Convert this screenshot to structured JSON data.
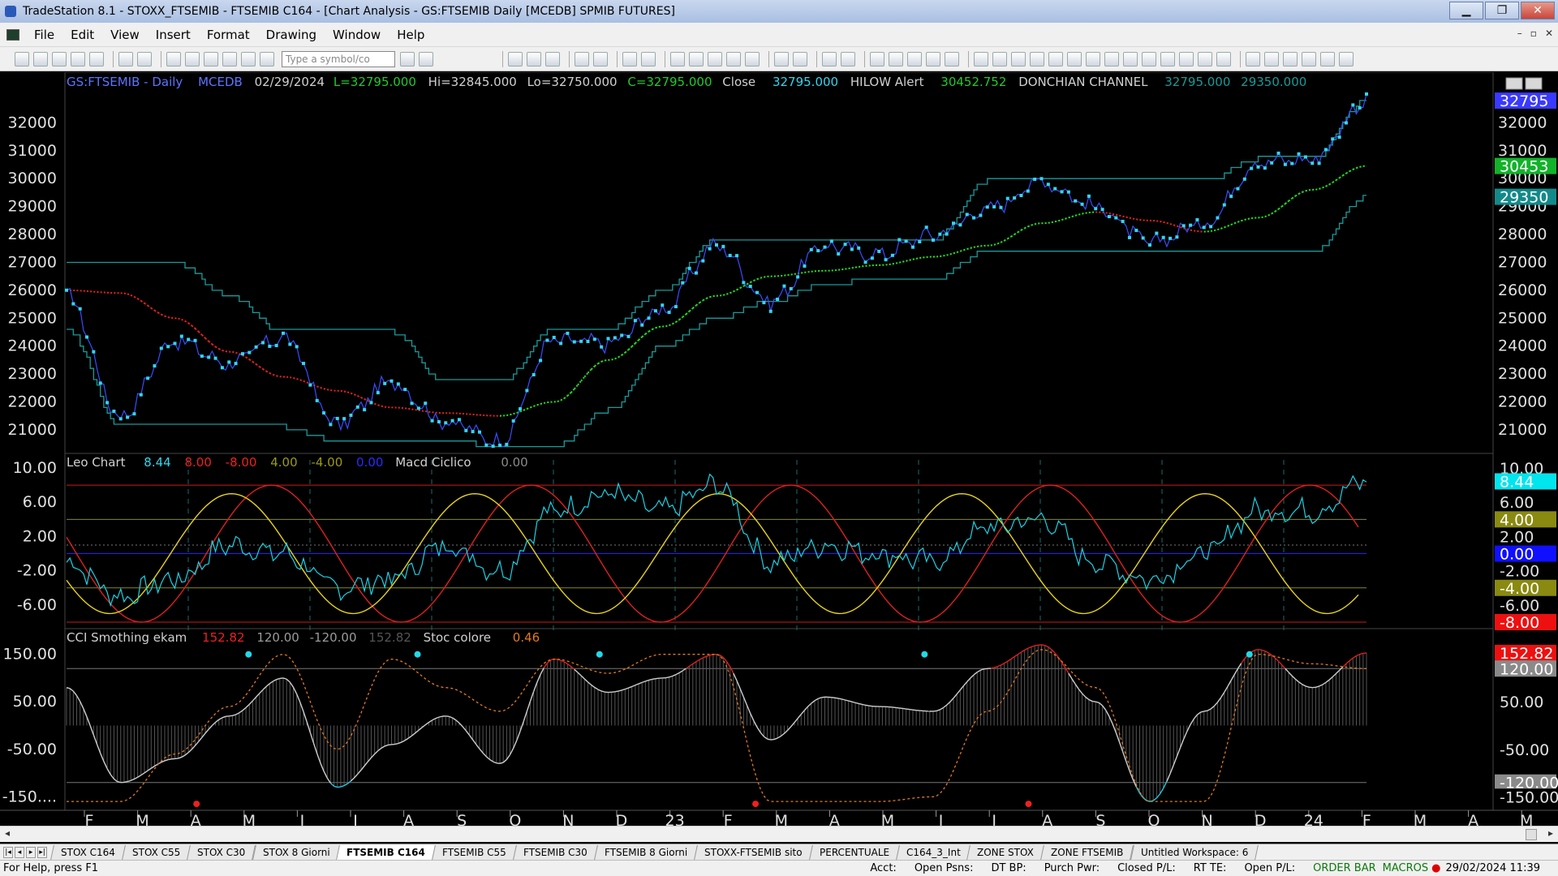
{
  "window": {
    "title": "TradeStation 8.1 - STOXX_FTSEMIB - FTSEMIB C164 - [Chart Analysis - GS:FTSEMIB  Daily  [MCEDB] SPMIB FUTURES]",
    "min": "▁",
    "max": "❐",
    "close": "✕"
  },
  "menu": [
    "File",
    "Edit",
    "View",
    "Insert",
    "Format",
    "Drawing",
    "Window",
    "Help"
  ],
  "mdi_buttons": [
    "–",
    "▫",
    "✕"
  ],
  "symbol_input": {
    "placeholder": "Type a symbol/co"
  },
  "header": {
    "symbol": "GS:FTSEMIB - Daily",
    "source": "MCEDB",
    "date": "02/29/2024",
    "last": "L=32795.000",
    "hi": "Hi=32845.000",
    "lo": "Lo=32750.000",
    "close_c": "C=32795.000",
    "close_label": "Close",
    "close_val": "32795.000",
    "hilow_label": "HILOW Alert",
    "hilow_val": "30452.752",
    "donchian_label": "DONCHIAN CHANNEL",
    "donchian_v1": "32795.000",
    "donchian_v2": "29350.000"
  },
  "leo_header": {
    "name": "Leo Chart",
    "v1": "8.44",
    "v2": "8.00",
    "v3": "-8.00",
    "v4": "4.00",
    "v5": "-4.00",
    "v6": "0.00",
    "macd_label": "Macd Ciclico",
    "macd_val": "0.00"
  },
  "cci_header": {
    "name": "CCI Smothing ekam",
    "v1": "152.82",
    "v2": "120.00",
    "v3": "-120.00",
    "v4": "152.82",
    "stoc_label": "Stoc colore",
    "stoc_val": "0.46"
  },
  "price_axis": {
    "ticks": [
      "32000",
      "31000",
      "30000",
      "29000",
      "28000",
      "27000",
      "26000",
      "25000",
      "24000",
      "23000",
      "22000",
      "21000"
    ],
    "badges": [
      {
        "text": "32795",
        "color": "#3a3aff"
      },
      {
        "text": "30453",
        "color": "#11b32a"
      },
      {
        "text": "29350",
        "color": "#138a8a"
      }
    ]
  },
  "leo_axis": {
    "ticks": [
      "10.00",
      "6.00",
      "2.00",
      "-2.00",
      "-6.00"
    ],
    "badges": [
      {
        "text": "10.00",
        "color": "#000000"
      },
      {
        "text": "8.44",
        "color": "#00e5ee"
      },
      {
        "text": "6.00",
        "color": "#000000"
      },
      {
        "text": "4.00",
        "color": "#8a8a10"
      },
      {
        "text": "2.00",
        "color": "#000000"
      },
      {
        "text": "0.00",
        "color": "#1010ff"
      },
      {
        "text": "-2.00",
        "color": "#000000"
      },
      {
        "text": "-4.00",
        "color": "#8a8a10"
      },
      {
        "text": "-6.00",
        "color": "#000000"
      },
      {
        "text": "-8.00",
        "color": "#ee1010"
      }
    ]
  },
  "cci_axis": {
    "ticks": [
      "150.00",
      "50.00",
      "-50.00",
      "-150...."
    ],
    "badges": [
      {
        "text": "152.82",
        "color": "#ee1010"
      },
      {
        "text": "120.00",
        "color": "#8a8a8a"
      },
      {
        "text": "50.00",
        "color": "#000000"
      },
      {
        "text": "-50.00",
        "color": "#000000"
      },
      {
        "text": "-120.00",
        "color": "#8a8a8a"
      },
      {
        "text": "-150.00",
        "color": "#000000"
      }
    ]
  },
  "time_axis": [
    "F",
    "M",
    "A",
    "M",
    "J",
    "J",
    "A",
    "S",
    "O",
    "N",
    "D",
    "23",
    "F",
    "M",
    "A",
    "M",
    "J",
    "J",
    "A",
    "S",
    "O",
    "N",
    "D",
    "24",
    "F",
    "M",
    "A",
    "M"
  ],
  "chart_data": [
    {
      "type": "line",
      "title": "GS:FTSEMIB - Daily",
      "series": [
        {
          "name": "Close",
          "x": [
            "2022-02",
            "2022-03",
            "2022-04",
            "2022-05",
            "2022-06",
            "2022-07",
            "2022-08",
            "2022-09",
            "2022-10",
            "2022-11",
            "2022-12",
            "2023-01",
            "2023-02",
            "2023-03",
            "2023-04",
            "2023-05",
            "2023-06",
            "2023-07",
            "2023-08",
            "2023-09",
            "2023-10",
            "2023-11",
            "2023-12",
            "2024-01",
            "2024-02"
          ],
          "values": [
            25800,
            21500,
            24200,
            23400,
            24300,
            21200,
            22700,
            21300,
            20600,
            24200,
            24100,
            25300,
            27600,
            25600,
            27600,
            27300,
            28000,
            28900,
            29900,
            29000,
            27700,
            28400,
            30600,
            30700,
            32795
          ]
        },
        {
          "name": "HILOW Alert",
          "values": [
            26000,
            25900,
            25000,
            23800,
            22900,
            22400,
            21800,
            21600,
            21500,
            22000,
            23500,
            24700,
            25800,
            26500,
            26700,
            26900,
            27200,
            27600,
            28400,
            28800,
            28500,
            28100,
            28600,
            29600,
            30453
          ]
        },
        {
          "name": "DONCHIAN CHANNEL",
          "upper": [
            27000,
            27000,
            27000,
            25800,
            24500,
            24500,
            24500,
            22700,
            22700,
            24600,
            24600,
            26000,
            27800,
            27800,
            27800,
            27800,
            27800,
            29900,
            29900,
            29900,
            29900,
            29900,
            30700,
            30700,
            32795
          ],
          "lower": [
            24600,
            21100,
            21100,
            21100,
            21100,
            20600,
            20600,
            20600,
            20400,
            20400,
            21700,
            24000,
            25000,
            25600,
            26200,
            26400,
            26400,
            27400,
            27400,
            27400,
            27400,
            27400,
            27400,
            27400,
            29350
          ]
        }
      ],
      "ylim": [
        20300,
        33000
      ]
    },
    {
      "type": "line",
      "title": "Leo Chart",
      "series": [
        {
          "name": "Leo Chart",
          "values": [
            -1,
            -5,
            -3,
            1,
            0,
            -4,
            -3,
            1,
            -2,
            5,
            7,
            5,
            8,
            -1,
            1,
            0,
            -1,
            3,
            4,
            -1,
            -3,
            0,
            5,
            5,
            8.44
          ]
        },
        {
          "name": "Macd Ciclico",
          "values": [
            -4,
            -6,
            2,
            6,
            -1,
            -5,
            2,
            5,
            8,
            9,
            4,
            -2,
            -6,
            -4,
            0,
            4,
            1,
            -3,
            -5,
            0,
            6,
            8,
            6,
            8,
            8
          ]
        }
      ],
      "levels": [
        8,
        4,
        0,
        -4,
        -8
      ],
      "ylim": [
        -8,
        10
      ]
    },
    {
      "type": "line",
      "title": "CCI Smothing ekam",
      "series": [
        {
          "name": "CCI Smothing ekam",
          "values": [
            80,
            -120,
            -70,
            20,
            100,
            -130,
            -40,
            20,
            -80,
            140,
            70,
            100,
            150,
            -30,
            60,
            40,
            30,
            120,
            170,
            50,
            -160,
            30,
            160,
            80,
            152.82
          ]
        },
        {
          "name": "Stoc colore",
          "values": [
            -160,
            -160,
            -60,
            40,
            150,
            -50,
            140,
            80,
            30,
            140,
            110,
            150,
            150,
            -160,
            -160,
            -160,
            -150,
            30,
            160,
            80,
            -160,
            -160,
            150,
            130,
            120
          ]
        }
      ],
      "levels": [
        120,
        -120
      ],
      "ylim": [
        -170,
        170
      ]
    }
  ],
  "tabs": [
    "STOX C164",
    "STOX C55",
    "STOX  C30",
    "STOX  8 Giorni",
    "FTSEMIB C164",
    "FTSEMIB C55",
    "FTSEMIB C30",
    "FTSEMIB  8 Giorni",
    "STOXX-FTSEMIB sito",
    "PERCENTUALE",
    "C164_3_Int",
    "ZONE STOX",
    "ZONE FTSEMIB",
    "Untitled Workspace:  6"
  ],
  "active_tab": 4,
  "statusbar": {
    "help": "For Help, press F1",
    "acct": "Acct:",
    "open_psns": "Open Psns:",
    "dt_bp": "DT BP:",
    "purch_pwr": "Purch Pwr:",
    "closed_pl": "Closed P/L:",
    "rt_te": "RT TE:",
    "open_pl": "Open P/L:",
    "order_bar": "ORDER BAR",
    "macros": "MACROS",
    "datetime": "29/02/2024 11:39"
  },
  "colors": {
    "price_bars": "#33d6ee",
    "price_trend_up": "#22dd22",
    "price_trend_down": "#dd2222",
    "donchian": "#1a9a9a",
    "leo": "#1ad2e6",
    "macd_a": "#dd2020",
    "macd_b": "#e8d418",
    "cci": "#cfcfcf",
    "stoc": "#e07a20"
  }
}
